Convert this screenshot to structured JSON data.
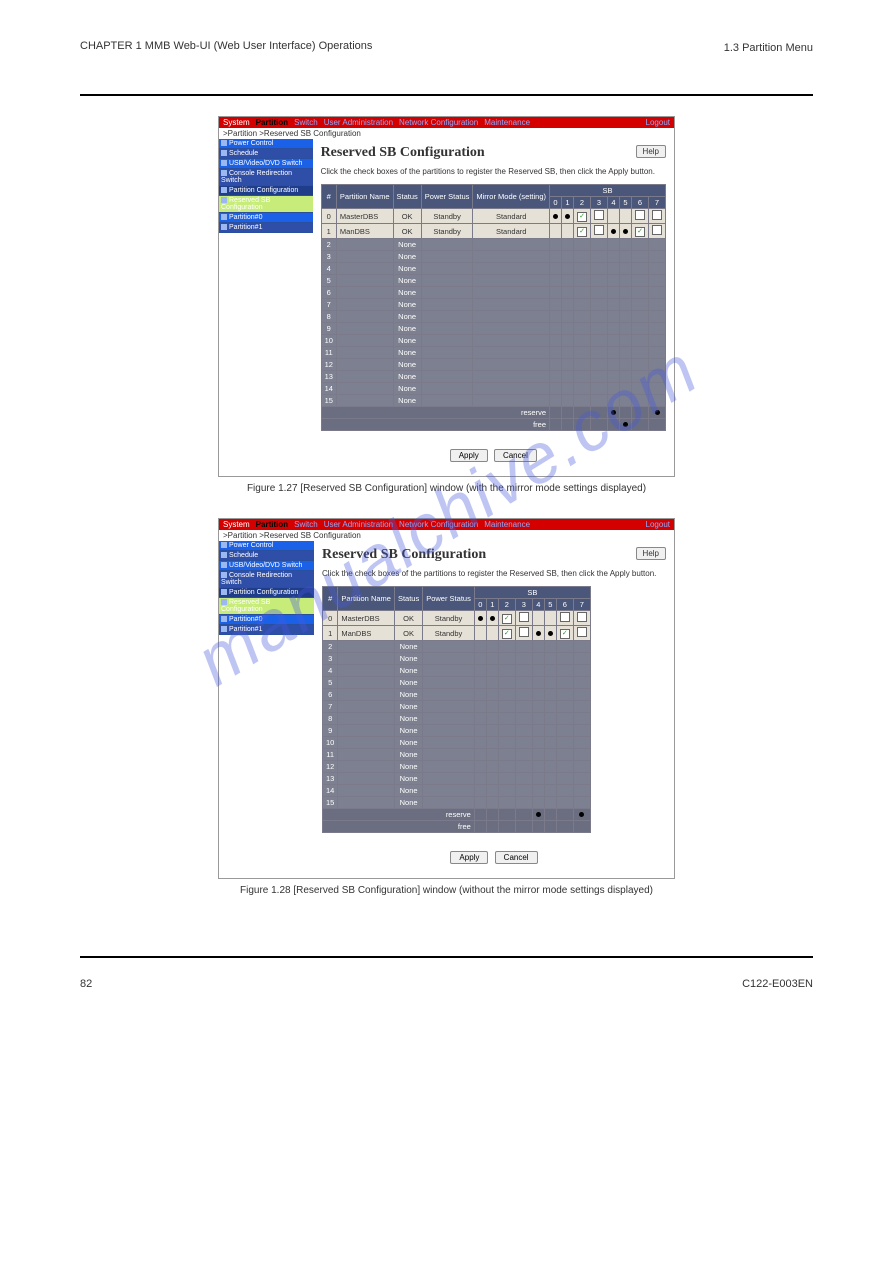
{
  "header": {
    "chapter": "CHAPTER 1  MMB Web-UI (Web User Interface) Operations",
    "section": "1.3  Partition Menu"
  },
  "watermark": "manualchive.com",
  "topnav": {
    "system": "System",
    "partition": "Partition",
    "switch": "Switch",
    "user_admin": "User Administration",
    "network": "Network Configuration",
    "maintenance": "Maintenance",
    "logout": "Logout"
  },
  "breadcrumb": ">Partition >Reserved SB Configuration",
  "sidebar": {
    "items": [
      {
        "label": "Power Control",
        "cls": "sb-bright"
      },
      {
        "label": "Schedule",
        "cls": "sb-alt"
      },
      {
        "label": "USB/Video/DVD Switch",
        "cls": "sb-bright"
      },
      {
        "label": "Console Redirection Switch",
        "cls": "sb-alt"
      },
      {
        "label": "Partition Configuration",
        "cls": "sb-dark"
      },
      {
        "label": "Reserved SB Configuration",
        "cls": "sb-current"
      },
      {
        "label": "Partition#0",
        "cls": "sb-bright"
      },
      {
        "label": "Partition#1",
        "cls": "sb-alt"
      }
    ]
  },
  "page_title": "Reserved SB Configuration",
  "help_label": "Help",
  "instruction": "Click the check boxes of the partitions to register the Reserved SB, then click the Apply button.",
  "columns": {
    "idx": "#",
    "pname": "Partition Name",
    "status": "Status",
    "pstatus": "Power Status",
    "mirror": "Mirror Mode (setting)",
    "sb": "SB"
  },
  "sb_cols": [
    "0",
    "1",
    "2",
    "3",
    "4",
    "5",
    "6",
    "7"
  ],
  "tableA": {
    "rows": [
      {
        "i": "0",
        "name": "MasterDBS",
        "status": "OK",
        "pstatus": "Standby",
        "mirror": "Standard",
        "sb": [
          "●",
          "●",
          "☑",
          "☐",
          "",
          "",
          "☐",
          "☐"
        ]
      },
      {
        "i": "1",
        "name": "ManDBS",
        "status": "OK",
        "pstatus": "Standby",
        "mirror": "Standard",
        "sb": [
          "",
          "",
          "☑",
          "☐",
          "●",
          "●",
          "☑",
          "☐"
        ]
      }
    ],
    "blank": [
      "2",
      "3",
      "4",
      "5",
      "6",
      "7",
      "8",
      "9",
      "10",
      "11",
      "12",
      "13",
      "14",
      "15"
    ],
    "none": "None",
    "reserve": "reserve",
    "free": "free",
    "reserve_dots": [
      "",
      "",
      "",
      "",
      "●",
      "",
      "",
      "●",
      ""
    ],
    "free_dots": [
      "",
      "",
      "",
      "",
      "",
      "●",
      "",
      "",
      "●"
    ]
  },
  "tableB": {
    "rows": [
      {
        "i": "0",
        "name": "MasterDBS",
        "status": "OK",
        "pstatus": "Standby",
        "sb": [
          "●",
          "●",
          "☑",
          "☐",
          "",
          "",
          "☐",
          "☐"
        ]
      },
      {
        "i": "1",
        "name": "ManDBS",
        "status": "OK",
        "pstatus": "Standby",
        "sb": [
          "",
          "",
          "☑",
          "☐",
          "●",
          "●",
          "☑",
          "☐"
        ]
      }
    ],
    "blank": [
      "2",
      "3",
      "4",
      "5",
      "6",
      "7",
      "8",
      "9",
      "10",
      "11",
      "12",
      "13",
      "14",
      "15"
    ],
    "none": "None",
    "reserve": "reserve",
    "free": "free",
    "reserve_dots": [
      "",
      "",
      "",
      "",
      "●",
      "",
      "",
      "●"
    ],
    "free_dots": [
      "",
      "",
      "",
      "",
      "",
      "",
      "",
      ""
    ]
  },
  "buttons": {
    "apply": "Apply",
    "cancel": "Cancel"
  },
  "captions": {
    "a": "Figure 1.27  [Reserved SB Configuration] window (with the mirror mode settings displayed)",
    "b": "Figure 1.28  [Reserved SB Configuration] window (without the mirror mode settings displayed)"
  },
  "footer": {
    "page": "82",
    "doc": "C122-E003EN"
  }
}
